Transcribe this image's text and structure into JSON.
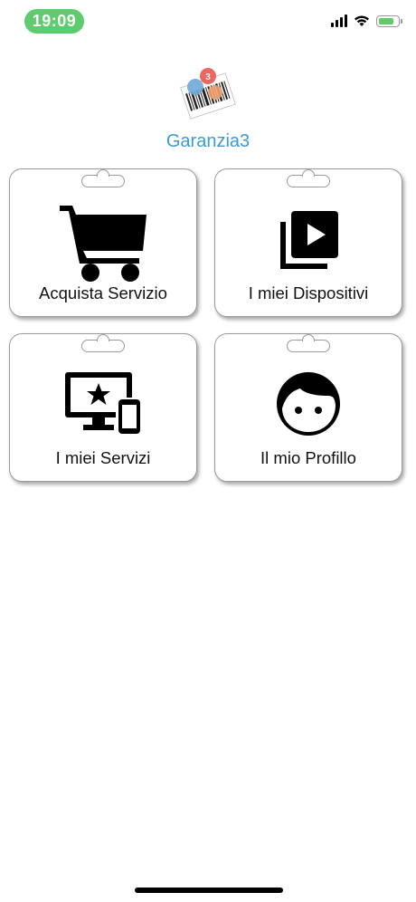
{
  "status_bar": {
    "time": "19:09",
    "colors": {
      "time_pill": "#5ecb6e",
      "battery_fill": "#5ecb6e"
    },
    "icons": [
      "cellular-signal-icon",
      "wifi-icon",
      "battery-charging-icon"
    ]
  },
  "brand": {
    "name": "Garanzia3",
    "logo_icon": "garanzia3-barcode-logo",
    "color": "#3b9bd0"
  },
  "menu": {
    "items": [
      {
        "label": "Acquista Servizio",
        "icon": "shopping-cart-icon"
      },
      {
        "label": "I miei Dispositivi",
        "icon": "video-library-icon"
      },
      {
        "label": "I miei Servizi",
        "icon": "devices-star-icon"
      },
      {
        "label": "Il mio Profillo",
        "icon": "face-icon"
      }
    ]
  }
}
